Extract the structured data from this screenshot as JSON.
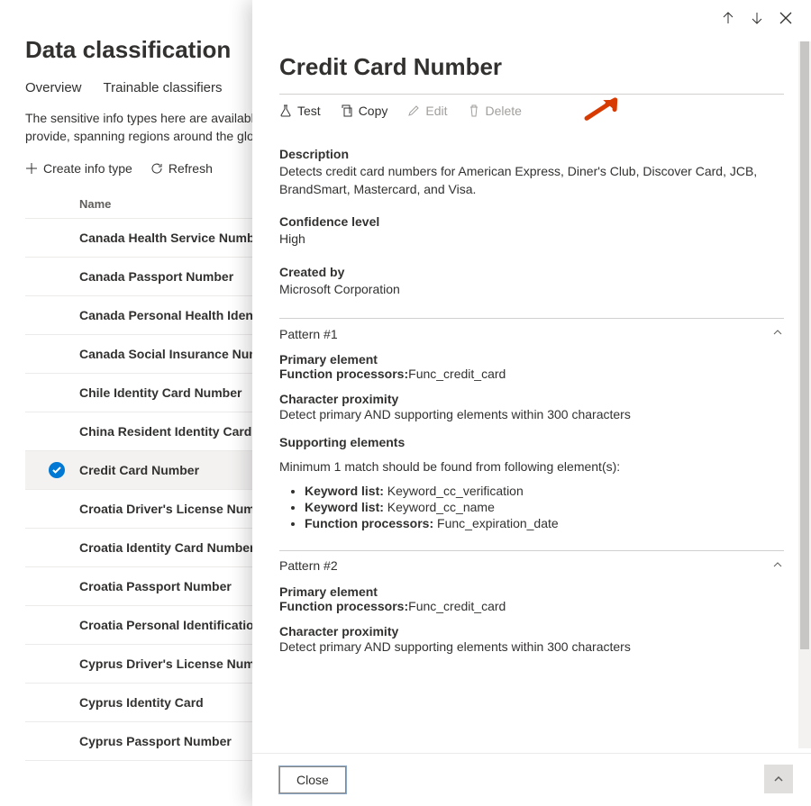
{
  "page": {
    "title": "Data classification",
    "tabs": [
      "Overview",
      "Trainable classifiers"
    ],
    "description": "The sensitive info types here are available to use in your security and compliance policies. These include a large collection of types we provide, spanning regions around the globe, as well as any custom types you have created.",
    "toolbar": {
      "create": "Create info type",
      "refresh": "Refresh"
    },
    "column_header": "Name",
    "rows": [
      "Canada Health Service Number",
      "Canada Passport Number",
      "Canada Personal Health Identification Number (PHIN)",
      "Canada Social Insurance Number",
      "Chile Identity Card Number",
      "China Resident Identity Card (PRC) Number",
      "Credit Card Number",
      "Croatia Driver's License Number",
      "Croatia Identity Card Number",
      "Croatia Passport Number",
      "Croatia Personal Identification (OIB) Number",
      "Cyprus Driver's License Number",
      "Cyprus Identity Card",
      "Cyprus Passport Number"
    ],
    "selected_index": 6
  },
  "panel": {
    "title": "Credit Card Number",
    "actions": {
      "test": "Test",
      "copy": "Copy",
      "edit": "Edit",
      "delete": "Delete"
    },
    "fields": {
      "description_label": "Description",
      "description_value": "Detects credit card numbers for American Express, Diner's Club, Discover Card, JCB, BrandSmart, Mastercard, and Visa.",
      "confidence_label": "Confidence level",
      "confidence_value": "High",
      "created_by_label": "Created by",
      "created_by_value": "Microsoft Corporation"
    },
    "patterns": [
      {
        "title": "Pattern #1",
        "primary_label": "Primary element",
        "function_label": "Function processors:",
        "function_value": "Func_credit_card",
        "proximity_label": "Character proximity",
        "proximity_value": "Detect primary AND supporting elements within 300 characters",
        "supporting_label": "Supporting elements",
        "supporting_intro": "Minimum 1 match should be found from following element(s):",
        "supporting_items": [
          {
            "label": "Keyword list:",
            "value": "Keyword_cc_verification"
          },
          {
            "label": "Keyword list:",
            "value": "Keyword_cc_name"
          },
          {
            "label": "Function processors:",
            "value": "Func_expiration_date"
          }
        ]
      },
      {
        "title": "Pattern #2",
        "primary_label": "Primary element",
        "function_label": "Function processors:",
        "function_value": "Func_credit_card",
        "proximity_label": "Character proximity",
        "proximity_value": "Detect primary AND supporting elements within 300 characters"
      }
    ],
    "close": "Close"
  }
}
